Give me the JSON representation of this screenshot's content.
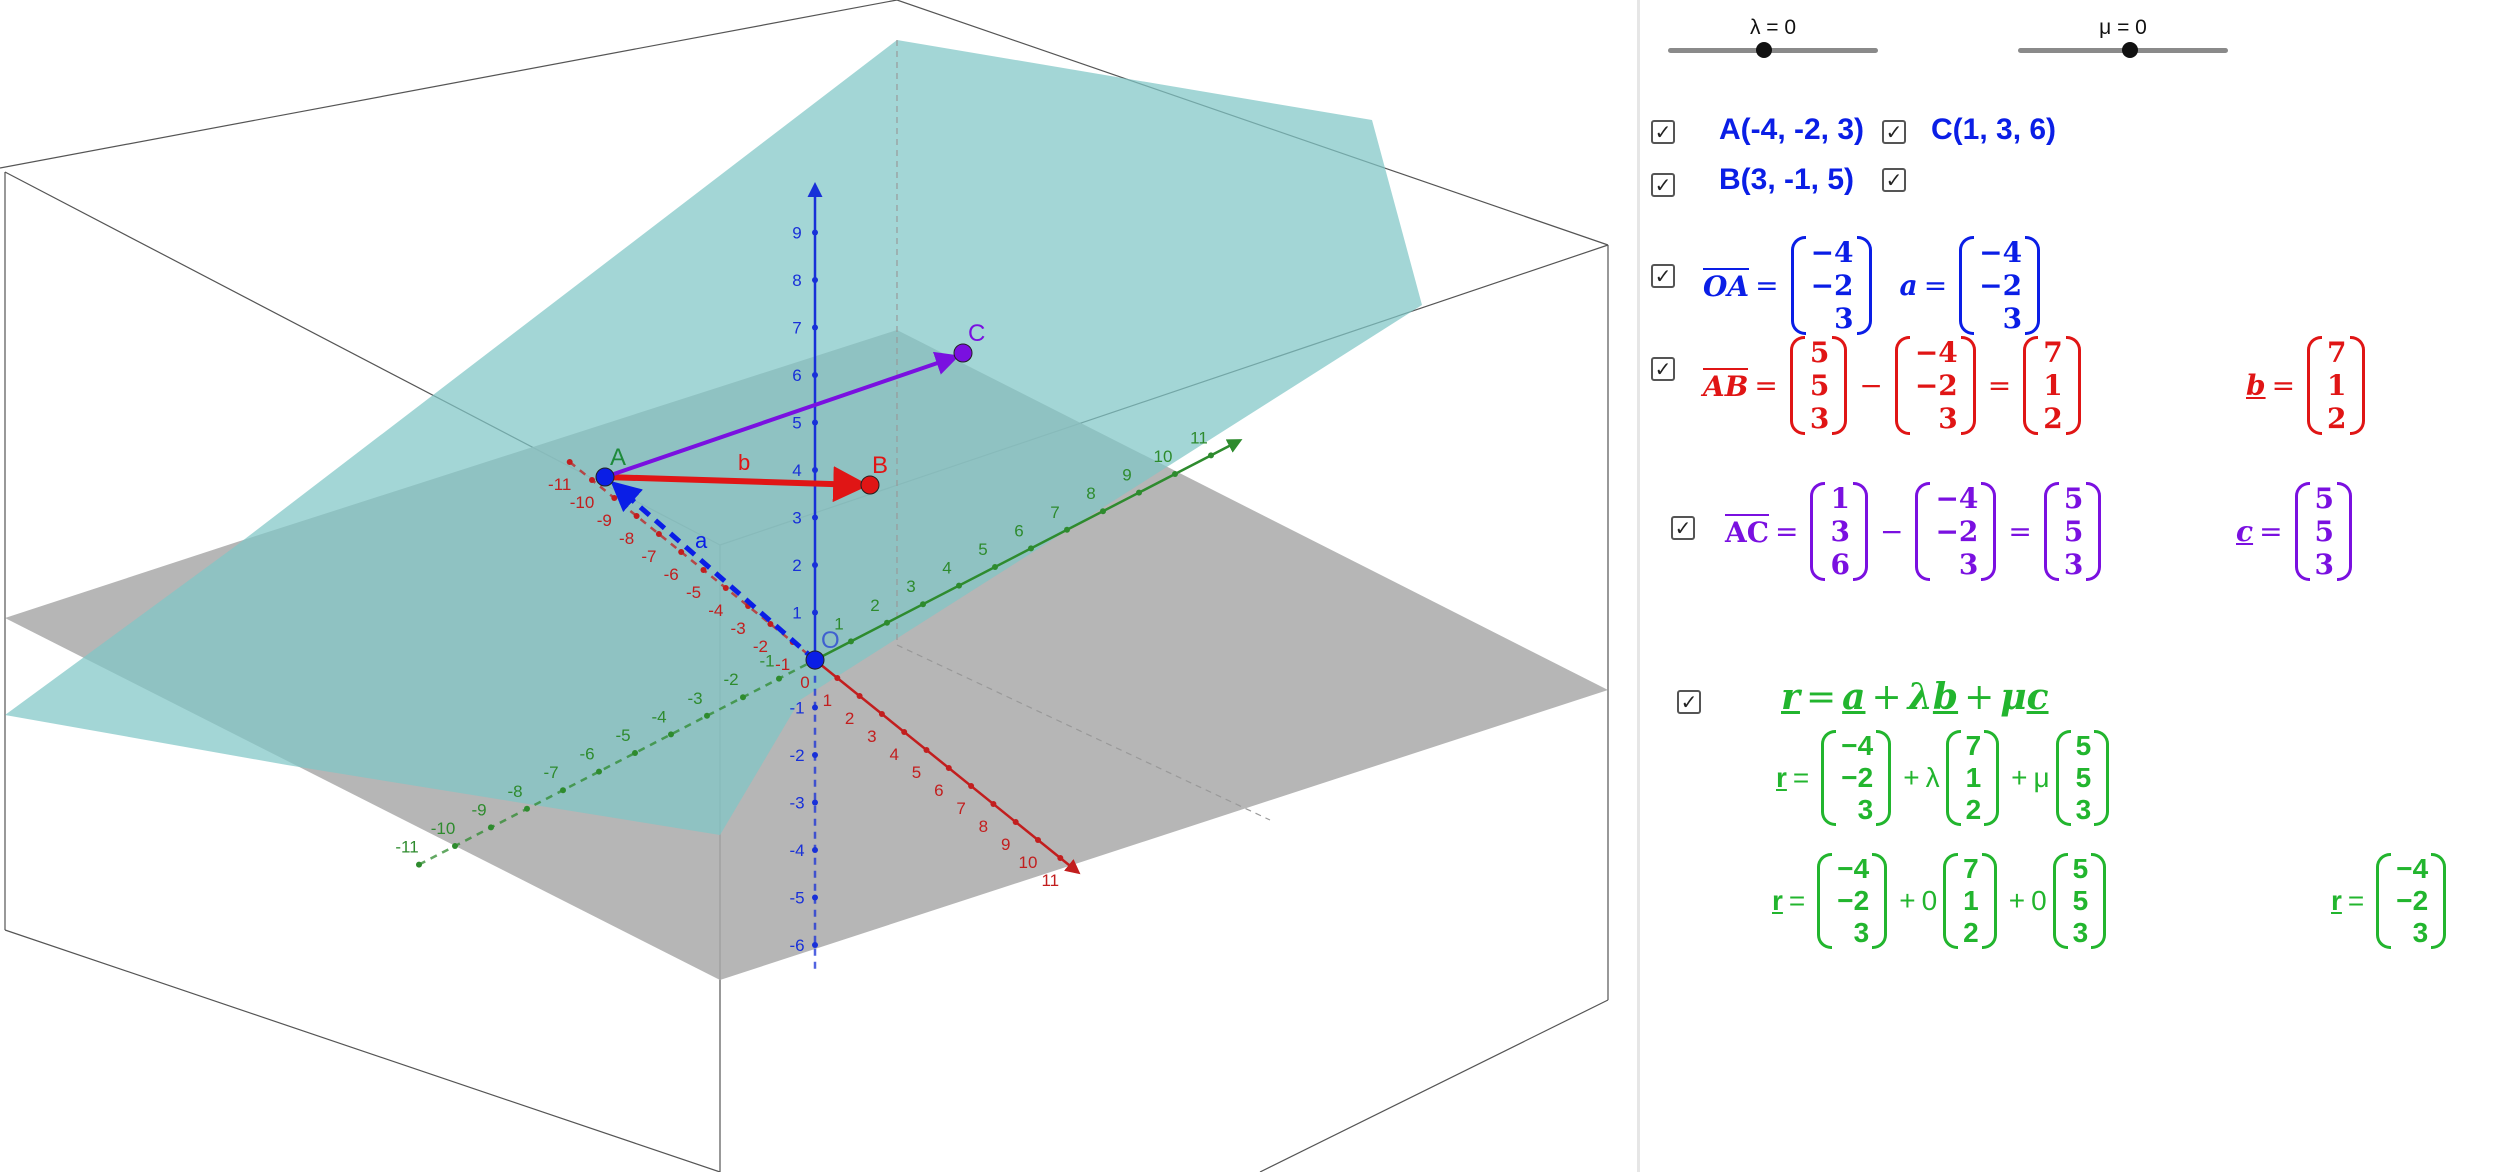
{
  "colors": {
    "blue": "#0a1ee6",
    "red": "#e01515",
    "purple": "#7a10e0",
    "green": "#22b52e",
    "plane_main": "#80c6c6",
    "plane_ground": "#a9a9a9",
    "axis_x": "#c21e1e",
    "axis_y": "#2e8b2e",
    "axis_z": "#1830d8"
  },
  "sliders": [
    {
      "label": "λ = 0",
      "value": 0
    },
    {
      "label": "μ = 0",
      "value": 0
    }
  ],
  "points": {
    "A": {
      "label": "A(-4, -2, 3)",
      "name": "A"
    },
    "B": {
      "label": "B(3, -1, 5)",
      "name": "B"
    },
    "C": {
      "label": "C(1, 3, 6)",
      "name": "C"
    },
    "O": {
      "name": "O"
    }
  },
  "vector_labels": {
    "a": "a",
    "b": "b"
  },
  "axis_ticks": {
    "x": [
      "-11",
      "-10",
      "-9",
      "-8",
      "-7",
      "-6",
      "-5",
      "-4",
      "-3",
      "-2",
      "-1",
      "0",
      "1",
      "2",
      "3",
      "4",
      "5",
      "6",
      "7",
      "8",
      "9",
      "10",
      "11"
    ],
    "y": [
      "-11",
      "-10",
      "-9",
      "-8",
      "-7",
      "-6",
      "-5",
      "-4",
      "-3",
      "-2",
      "-1",
      "1",
      "2",
      "3",
      "4",
      "5",
      "6",
      "7",
      "8",
      "9",
      "10",
      "11"
    ],
    "z": [
      "-6",
      "-5",
      "-4",
      "-3",
      "-2",
      "-1",
      "1",
      "2",
      "3",
      "4",
      "5",
      "6",
      "7",
      "8",
      "9"
    ]
  },
  "algebra": {
    "checkbox_mark": "✓",
    "OA": {
      "lhs": "OA",
      "vec": [
        "−4",
        "−2",
        "3"
      ],
      "name": "a",
      "result": [
        "−4",
        "−2",
        "3"
      ]
    },
    "AB": {
      "lhs": "AB",
      "v1": [
        "5",
        "5",
        "3"
      ],
      "v2": [
        "−4",
        "−2",
        "3"
      ],
      "result": [
        "7",
        "1",
        "2"
      ],
      "name": "b",
      "named": [
        "7",
        "1",
        "2"
      ]
    },
    "AC": {
      "lhs": "AC",
      "v1": [
        "1",
        "3",
        "6"
      ],
      "v2": [
        "−4",
        "−2",
        "3"
      ],
      "result": [
        "5",
        "5",
        "3"
      ],
      "name": "c",
      "named": [
        "5",
        "5",
        "3"
      ]
    },
    "eq": {
      "title": {
        "r": "r",
        "a": "a",
        "lambda": "λ",
        "b": "b",
        "mu": "μ",
        "c": "c"
      },
      "r": "r",
      "lambda": "λ",
      "mu": "μ",
      "a_vec": [
        "−4",
        "−2",
        "3"
      ],
      "b_vec": [
        "7",
        "1",
        "2"
      ],
      "c_vec": [
        "5",
        "5",
        "3"
      ],
      "lambda_val": "0",
      "mu_val": "0",
      "result": [
        "−4",
        "−2",
        "3"
      ]
    }
  }
}
